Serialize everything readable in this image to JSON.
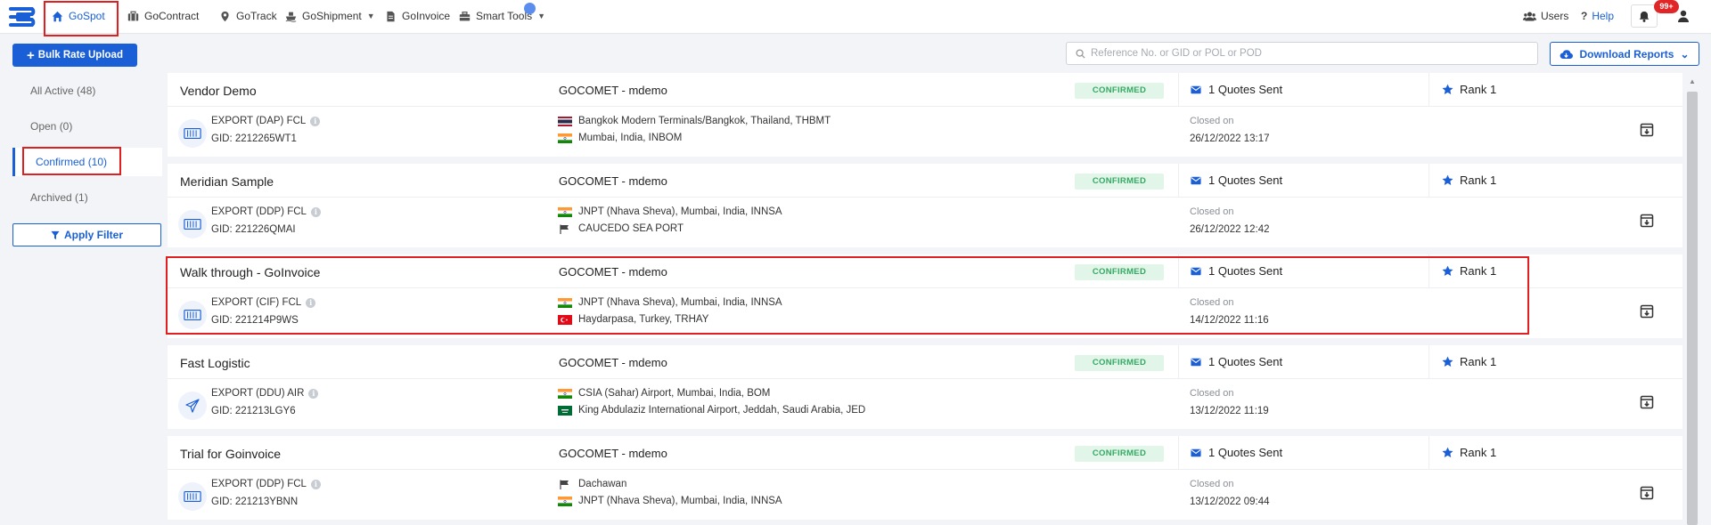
{
  "nav": {
    "items": [
      {
        "label": "GoSpot",
        "icon": "home-icon",
        "active": true
      },
      {
        "label": "GoContract",
        "icon": "briefcase-icon"
      },
      {
        "label": "GoTrack",
        "icon": "map-pin-icon"
      },
      {
        "label": "GoShipment",
        "icon": "ship-icon"
      },
      {
        "label": "GoInvoice",
        "icon": "document-icon"
      },
      {
        "label": "Smart Tools",
        "icon": "toolbox-icon"
      }
    ],
    "users_label": "Users",
    "help_label": "Help",
    "notifications_count": "99+"
  },
  "toolbar": {
    "bulk_upload_label": "Bulk Rate Upload",
    "search_placeholder": "Reference No. or GID or POL or POD",
    "download_label": "Download Reports"
  },
  "sidebar": {
    "tabs": [
      {
        "label": "All Active (48)"
      },
      {
        "label": "Open (0)"
      },
      {
        "label": "Confirmed (10)",
        "active": true
      },
      {
        "label": "Archived (1)"
      }
    ],
    "filter_label": "Apply Filter"
  },
  "cards": [
    {
      "title": "Vendor Demo",
      "vendor": "GOCOMET - mdemo",
      "status": "CONFIRMED",
      "quotes": "1 Quotes Sent",
      "rank": "Rank 1",
      "mode": "container",
      "type": "EXPORT (DAP) FCL",
      "gid": "GID: 2212265WT1",
      "pol": {
        "flag": "th",
        "name": "Bangkok Modern Terminals/Bangkok, Thailand, THBMT"
      },
      "pod": {
        "flag": "in",
        "name": "Mumbai, India, INBOM"
      },
      "closed_label": "Closed on",
      "closed_date": "26/12/2022 13:17"
    },
    {
      "title": "Meridian Sample",
      "vendor": "GOCOMET - mdemo",
      "status": "CONFIRMED",
      "quotes": "1 Quotes Sent",
      "rank": "Rank 1",
      "mode": "container",
      "type": "EXPORT (DDP) FCL",
      "gid": "GID: 221226QMAI",
      "pol": {
        "flag": "in",
        "name": "JNPT (Nhava Sheva), Mumbai, India, INNSA"
      },
      "pod": {
        "flag": "generic",
        "name": "CAUCEDO SEA PORT"
      },
      "closed_label": "Closed on",
      "closed_date": "26/12/2022 12:42"
    },
    {
      "title": "Walk through - GoInvoice",
      "vendor": "GOCOMET - mdemo",
      "status": "CONFIRMED",
      "quotes": "1 Quotes Sent",
      "rank": "Rank 1",
      "mode": "container",
      "type": "EXPORT (CIF) FCL",
      "gid": "GID: 221214P9WS",
      "pol": {
        "flag": "in",
        "name": "JNPT (Nhava Sheva), Mumbai, India, INNSA"
      },
      "pod": {
        "flag": "tr",
        "name": "Haydarpasa, Turkey, TRHAY"
      },
      "closed_label": "Closed on",
      "closed_date": "14/12/2022 11:16"
    },
    {
      "title": "Fast Logistic",
      "vendor": "GOCOMET - mdemo",
      "status": "CONFIRMED",
      "quotes": "1 Quotes Sent",
      "rank": "Rank 1",
      "mode": "air",
      "type": "EXPORT (DDU) AIR",
      "gid": "GID: 221213LGY6",
      "pol": {
        "flag": "in",
        "name": "CSIA (Sahar) Airport, Mumbai, India, BOM"
      },
      "pod": {
        "flag": "sa",
        "name": "King Abdulaziz International Airport, Jeddah, Saudi Arabia, JED"
      },
      "closed_label": "Closed on",
      "closed_date": "13/12/2022 11:19"
    },
    {
      "title": "Trial for Goinvoice",
      "vendor": "GOCOMET - mdemo",
      "status": "CONFIRMED",
      "quotes": "1 Quotes Sent",
      "rank": "Rank 1",
      "mode": "container",
      "type": "EXPORT (DDP) FCL",
      "gid": "GID: 221213YBNN",
      "pol": {
        "flag": "generic",
        "name": "Dachawan"
      },
      "pod": {
        "flag": "in",
        "name": "JNPT (Nhava Sheva), Mumbai, India, INNSA"
      },
      "closed_label": "Closed on",
      "closed_date": "13/12/2022 09:44"
    }
  ],
  "colors": {
    "primary": "#1a5fd6",
    "confirmed_bg": "#e2f5e9",
    "confirmed_text": "#35a963",
    "highlight": "#e02020",
    "badge": "#e02626"
  }
}
